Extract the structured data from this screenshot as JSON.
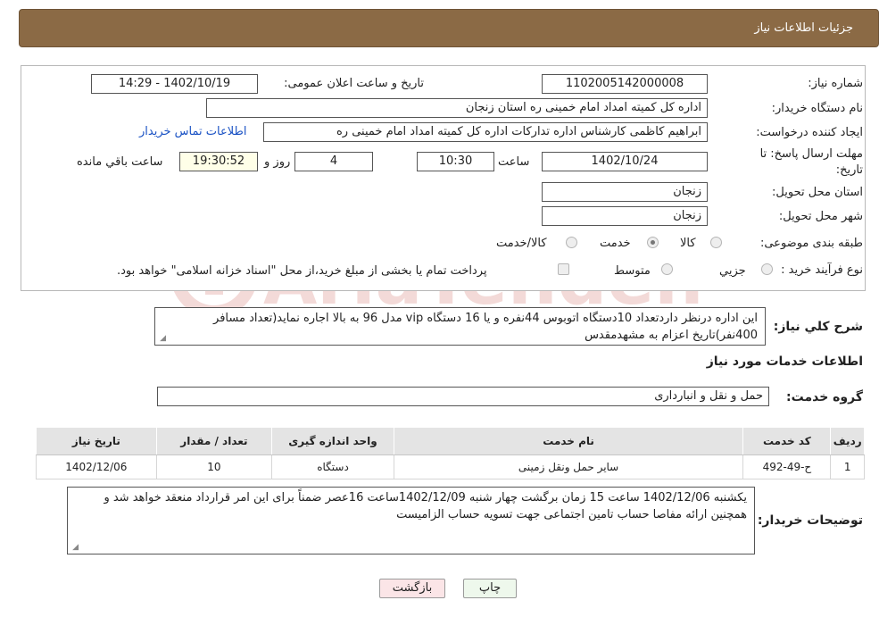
{
  "header": {
    "title": "جزئیات اطلاعات نیاز"
  },
  "form": {
    "need_number_label": "شماره نیاز:",
    "need_number": "1102005142000008",
    "announce_label": "تاریخ و ساعت اعلان عمومی:",
    "announce_value": "1402/10/19 - 14:29",
    "buyer_org_label": "نام دستگاه خریدار:",
    "buyer_org": "اداره کل کمیته امداد امام خمینی  ره  استان زنجان",
    "creator_label": "ایجاد کننده درخواست:",
    "creator": "ابراهیم  کاظمی  کارشناس اداره تدارکات  اداره کل کمیته امداد امام خمینی  ره",
    "contact_link": "اطلاعات تماس خریدار",
    "deadline_label_1": "مهلت ارسال پاسخ: تا",
    "deadline_label_2": "تاریخ:",
    "deadline_date": "1402/10/24",
    "time_label": "ساعت",
    "deadline_time": "10:30",
    "days_value": "4",
    "days_label": "روز و",
    "remaining_time": "19:30:52",
    "remaining_label": "ساعت باقي مانده",
    "province_label": "استان محل تحویل:",
    "province": "زنجان",
    "city_label": "شهر محل تحویل:",
    "city": "زنجان",
    "category_label": "طبقه بندی موضوعی:",
    "category_options": [
      {
        "label": "کالا",
        "selected": false
      },
      {
        "label": "خدمت",
        "selected": true
      },
      {
        "label": "کالا/خدمت",
        "selected": false
      }
    ],
    "process_label": "نوع فرآیند خرید :",
    "process_options": [
      {
        "label": "جزیي",
        "selected": false
      },
      {
        "label": "متوسط",
        "selected": false
      }
    ],
    "payment_checkbox_label": "پرداخت تمام یا بخشی از مبلغ خرید،از محل \"اسناد خزانه اسلامی\" خواهد بود."
  },
  "description": {
    "label": "شرح كلي نياز:",
    "text": "این اداره درنظر داردتعداد 10دستگاه اتوبوس 44نفره  و یا 16 دستگاه vip مدل 96 به بالا  اجاره نماید(تعداد مسافر 400نفر)تاریخ اعزام به مشهدمقدس"
  },
  "services_section": {
    "title": "اطلاعات خدمات مورد نیاز",
    "group_label": "گروه خدمت:",
    "group_value": "حمل و نقل و انبارداری"
  },
  "table": {
    "headers": [
      "ردیف",
      "کد خدمت",
      "نام خدمت",
      "واحد اندازه گیری",
      "تعداد / مقدار",
      "تاریخ نیاز"
    ],
    "rows": [
      [
        "1",
        "ح-49-492",
        "سایر حمل ونقل زمینی",
        "دستگاه",
        "10",
        "1402/12/06"
      ]
    ]
  },
  "buyer_notes": {
    "label": "توضیحات خریدار:",
    "text": "یکشنبه 1402/12/06 ساعت 15 زمان برگشت چهار شنبه  1402/12/09ساعت 16عصر ضمناً برای این امر قرارداد منعقد خواهد شد و همچنین ارائه مفاصا حساب تامین اجتماعی جهت تسویه حساب الزامیست"
  },
  "buttons": {
    "print": "چاپ",
    "back": "بازگشت"
  },
  "watermark": {
    "text": "AriaTender.neT"
  }
}
